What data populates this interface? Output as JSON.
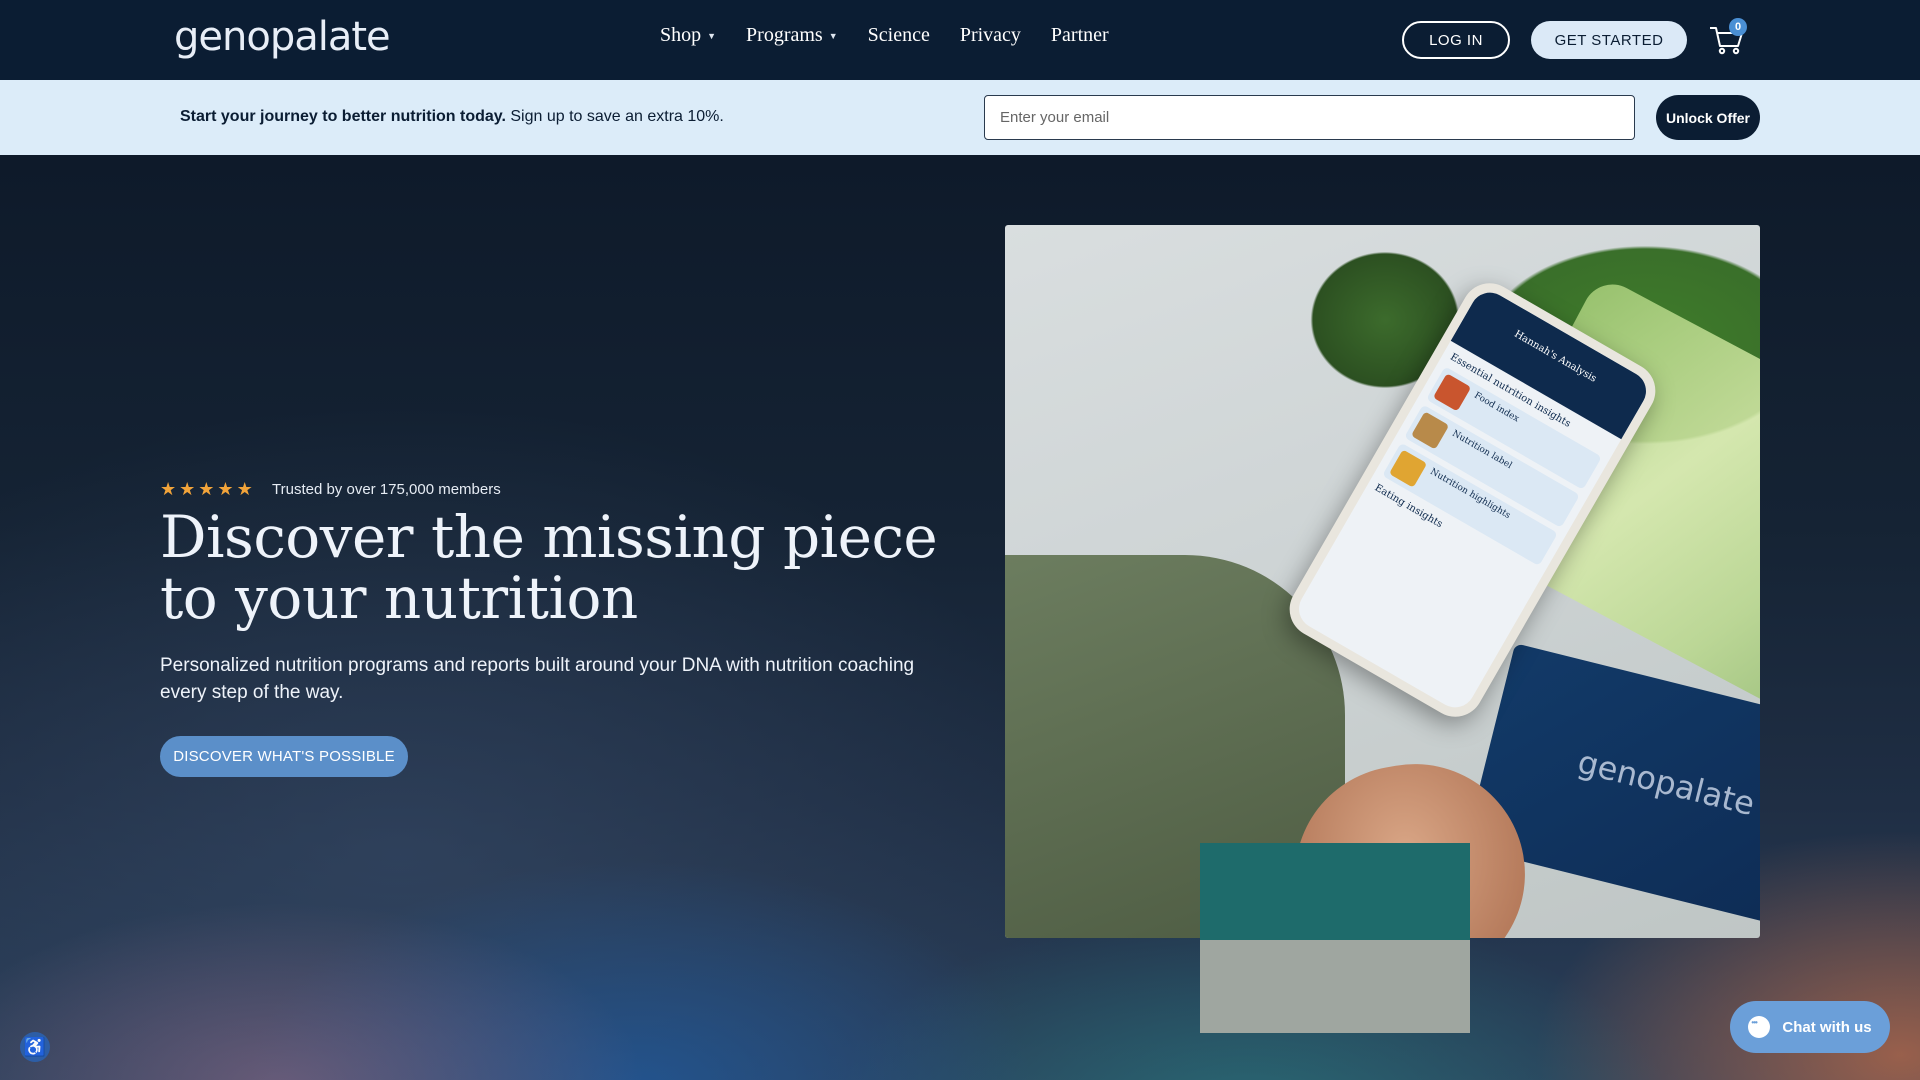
{
  "brand": {
    "logo_text": "genopalate"
  },
  "nav": {
    "items": [
      {
        "label": "Shop",
        "has_caret": true
      },
      {
        "label": "Programs",
        "has_caret": true
      },
      {
        "label": "Science",
        "has_caret": false
      },
      {
        "label": "Privacy",
        "has_caret": false
      },
      {
        "label": "Partner",
        "has_caret": false
      }
    ],
    "login_label": "LOG IN",
    "get_started_label": "GET STARTED",
    "cart_count": "0"
  },
  "offer": {
    "bold_text": "Start your journey to better nutrition today.",
    "text": " Sign up to save an extra 10%.",
    "email_placeholder": "Enter your email",
    "button_label": "Unlock Offer"
  },
  "hero": {
    "rating_stars": 5,
    "trust_text": "Trusted by over 175,000 members",
    "headline": "Discover the missing piece to your nutrition",
    "subheadline": "Personalized nutrition programs and reports built around your DNA with nutrition coaching every step of the way.",
    "cta_label": "DISCOVER WHAT'S POSSIBLE"
  },
  "phone_screen": {
    "title": "Hannah's Analysis",
    "section_title": "Essential nutrition insights",
    "rows": [
      "Food index",
      "Nutrition label",
      "Nutrition highlights"
    ],
    "section_title_2": "Eating insights"
  },
  "card_logo_text": "genopalate",
  "chat": {
    "label": "Chat with us"
  },
  "colors": {
    "nav_bg": "#0b1d33",
    "offer_bg": "#dcecf9",
    "star": "#f2a43a",
    "cta": "#5b8fc9",
    "chat": "#6b9fd9"
  },
  "icons": {
    "cart": "cart-icon",
    "accessibility": "accessibility-icon",
    "chat": "chat-bubble-icon",
    "star": "star-icon"
  }
}
